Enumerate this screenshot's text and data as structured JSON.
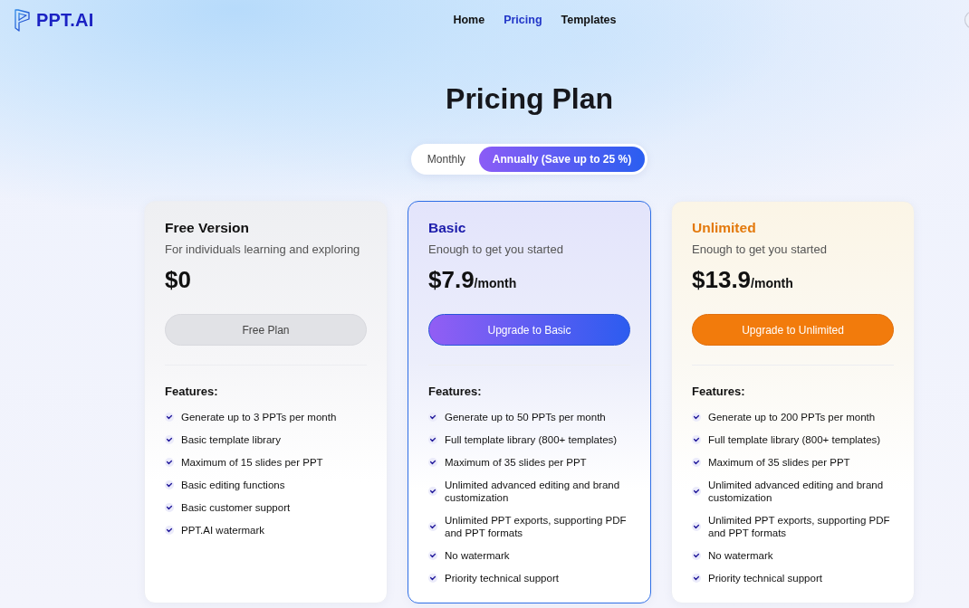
{
  "logo": {
    "text": "PPT.AI"
  },
  "nav": [
    {
      "label": "Home",
      "selected": false
    },
    {
      "label": "Pricing",
      "selected": true
    },
    {
      "label": "Templates",
      "selected": false
    }
  ],
  "title": "Pricing Plan",
  "billing_toggle": [
    {
      "label": "Monthly",
      "selected": false
    },
    {
      "label": "Annually (Save up to 25 %)",
      "selected": true
    }
  ],
  "plans": [
    {
      "kind": "free",
      "highlighted": false,
      "name": "Free Version",
      "tagline": "For individuals learning and exploring",
      "price": "$0",
      "button": "Free Plan",
      "features_heading": "Features:",
      "features": [
        "Generate up to 3 PPTs per month",
        "Basic template library",
        "Maximum of 15 slides per PPT",
        "Basic editing functions",
        "Basic customer support",
        "PPT.AI watermark"
      ]
    },
    {
      "kind": "basic",
      "highlighted": true,
      "name": "Basic",
      "tagline": "Enough to get you started",
      "price": "$7.9",
      "period": "/month",
      "button": "Upgrade to Basic",
      "features_heading": "Features:",
      "features": [
        "Generate up to 50 PPTs per month",
        "Full template library (800+ templates)",
        "Maximum of 35 slides per PPT",
        "Unlimited advanced editing and brand customization",
        "Unlimited PPT exports, supporting PDF and PPT formats",
        "No watermark",
        "Priority technical support"
      ]
    },
    {
      "kind": "unlimited",
      "highlighted": false,
      "name": "Unlimited",
      "tagline": "Enough to get you started",
      "price": "$13.9",
      "period": "/month",
      "button": "Upgrade to Unlimited",
      "features_heading": "Features:",
      "features": [
        "Generate up to 200 PPTs per month",
        "Full template library (800+ templates)",
        "Maximum of 35 slides per PPT",
        "Unlimited advanced editing and brand customization",
        "Unlimited PPT exports, supporting PDF and PPT formats",
        "No watermark",
        "Priority technical support"
      ]
    }
  ]
}
